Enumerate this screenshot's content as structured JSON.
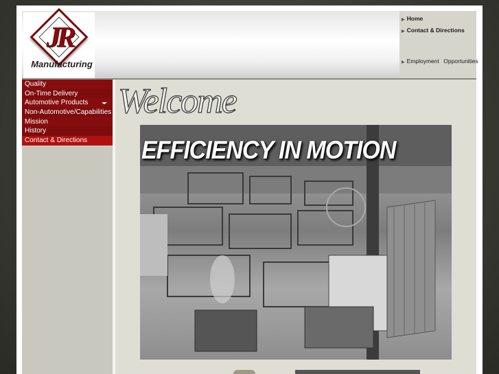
{
  "brand": {
    "logo_mark": "JR",
    "logo_text": "Manufacturing"
  },
  "top_nav": [
    {
      "label": "Home"
    },
    {
      "label": "Contact & Directions"
    },
    {
      "label": "Employment Opportunities"
    }
  ],
  "side_menu": [
    {
      "label": "Quality"
    },
    {
      "label": "On-Time Delivery"
    },
    {
      "label": "Automotive Products"
    },
    {
      "label": "Non-Automotive/Capabilities"
    },
    {
      "label": "Mission"
    },
    {
      "label": "History"
    },
    {
      "label": "Contact & Directions"
    }
  ],
  "main": {
    "welcome_heading": "Welcome",
    "hero_headline": "EFFICIENCY IN MOTION"
  },
  "colors": {
    "menu_red": "#7d0c0c",
    "menu_active_red": "#b01010",
    "panel_gray": "#deded5",
    "background": "#3b3d35"
  },
  "icons": {
    "topnav_bullet": "arrow-right-icon",
    "dropdown": "caret-down-icon"
  }
}
